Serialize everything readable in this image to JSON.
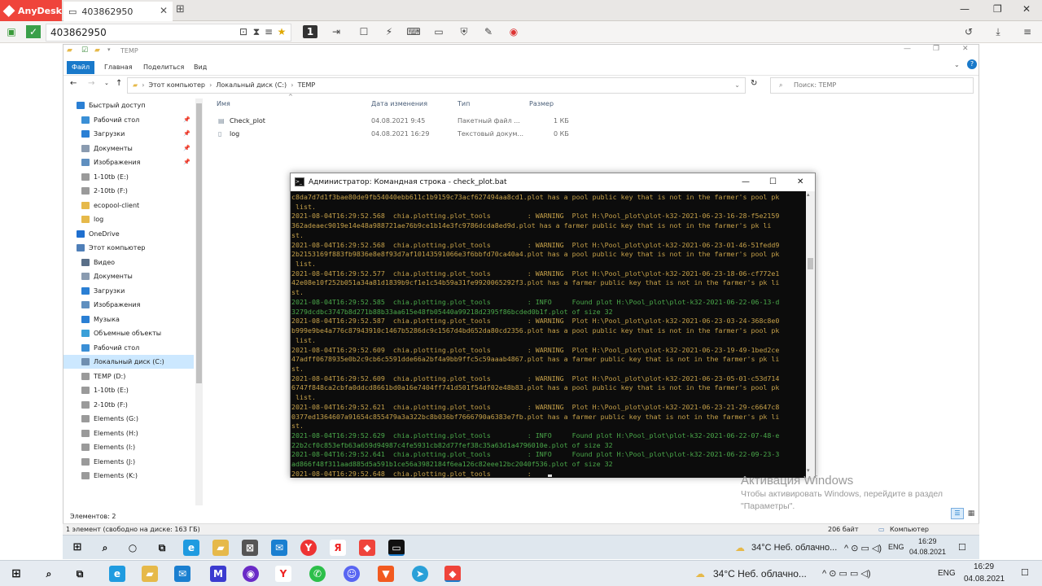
{
  "anydesk": {
    "brand": "AnyDesk",
    "tab_title": "403862950",
    "address": "403862950",
    "active_monitor": "1"
  },
  "explorer": {
    "quick_title": "TEMP",
    "ribbon_tabs": [
      "Файл",
      "Главная",
      "Поделиться",
      "Вид"
    ],
    "path": [
      "Этот компьютер",
      "Локальный диск (C:)",
      "TEMP"
    ],
    "search_placeholder": "Поиск: TEMP",
    "sidebar": [
      {
        "label": "Быстрый доступ",
        "color": "#2a7fd4",
        "pinned": false,
        "indent": 0
      },
      {
        "label": "Рабочий стол",
        "color": "#3a8fd6",
        "pinned": true,
        "indent": 1
      },
      {
        "label": "Загрузки",
        "color": "#2a7fd4",
        "pinned": true,
        "indent": 1
      },
      {
        "label": "Документы",
        "color": "#8a9bb0",
        "pinned": true,
        "indent": 1
      },
      {
        "label": "Изображения",
        "color": "#5f8fbf",
        "pinned": true,
        "indent": 1
      },
      {
        "label": "1-10tb (E:)",
        "color": "#9a9a9a",
        "pinned": false,
        "indent": 1
      },
      {
        "label": "2-10tb (F:)",
        "color": "#9a9a9a",
        "pinned": false,
        "indent": 1
      },
      {
        "label": "ecopool-client",
        "color": "#e6b94a",
        "pinned": false,
        "indent": 1
      },
      {
        "label": "log",
        "color": "#e6b94a",
        "pinned": false,
        "indent": 1
      },
      {
        "label": "OneDrive",
        "color": "#1f6fcf",
        "pinned": false,
        "indent": 0
      },
      {
        "label": "Этот компьютер",
        "color": "#4f7fb8",
        "pinned": false,
        "indent": 0
      },
      {
        "label": "Видео",
        "color": "#5a6f88",
        "pinned": false,
        "indent": 1
      },
      {
        "label": "Документы",
        "color": "#8a9bb0",
        "pinned": false,
        "indent": 1
      },
      {
        "label": "Загрузки",
        "color": "#2a7fd4",
        "pinned": false,
        "indent": 1
      },
      {
        "label": "Изображения",
        "color": "#5f8fbf",
        "pinned": false,
        "indent": 1
      },
      {
        "label": "Музыка",
        "color": "#2a7fd4",
        "pinned": false,
        "indent": 1
      },
      {
        "label": "Объемные объекты",
        "color": "#3aa0d8",
        "pinned": false,
        "indent": 1
      },
      {
        "label": "Рабочий стол",
        "color": "#3a8fd6",
        "pinned": false,
        "indent": 1
      },
      {
        "label": "Локальный диск (C:)",
        "color": "#6f8fb0",
        "pinned": false,
        "indent": 1
      },
      {
        "label": "TEMP (D:)",
        "color": "#9a9a9a",
        "pinned": false,
        "indent": 1
      },
      {
        "label": "1-10tb (E:)",
        "color": "#9a9a9a",
        "pinned": false,
        "indent": 1
      },
      {
        "label": "2-10tb (F:)",
        "color": "#9a9a9a",
        "pinned": false,
        "indent": 1
      },
      {
        "label": "Elements (G:)",
        "color": "#9a9a9a",
        "pinned": false,
        "indent": 1
      },
      {
        "label": "Elements (H:)",
        "color": "#9a9a9a",
        "pinned": false,
        "indent": 1
      },
      {
        "label": "Elements (I:)",
        "color": "#9a9a9a",
        "pinned": false,
        "indent": 1
      },
      {
        "label": "Elements (J:)",
        "color": "#9a9a9a",
        "pinned": false,
        "indent": 1
      },
      {
        "label": "Elements (K:)",
        "color": "#9a9a9a",
        "pinned": false,
        "indent": 1
      }
    ],
    "selected_sidebar_index": 18,
    "columns": [
      "Имя",
      "Дата изменения",
      "Тип",
      "Размер"
    ],
    "files": [
      {
        "name": "Check_plot",
        "date": "04.08.2021 9:45",
        "type": "Пакетный файл ...",
        "size": "1 КБ"
      },
      {
        "name": "log",
        "date": "04.08.2021 16:29",
        "type": "Текстовый докум...",
        "size": "0 КБ"
      }
    ],
    "elements_count": "Элементов: 2",
    "status_left": "1 элемент (свободно на диске: 163 ГБ)",
    "status_size": "206 байт",
    "status_location": "Компьютер"
  },
  "cmd": {
    "title": "Администратор: Командная строка - check_plot.bat",
    "lines": [
      {
        "text": "c8da7d7d1f3bae80de9fb54040ebb611c1b9159c73acf627494aa8cd1.plot has a pool public key that is not in the farmer's pool pk",
        "cls": "warn"
      },
      {
        "text": " list.",
        "cls": "warn"
      },
      {
        "text": "2021-08-04T16:29:52.568  chia.plotting.plot_tools         : WARNING  Plot H:\\Pool_plot\\plot-k32-2021-06-23-16-28-f5e2159",
        "cls": "warn"
      },
      {
        "text": "362adeaec9019e14e48a988721ae76b9ce1b14e3fc9786dcda8ed9d.plot has a farmer public key that is not in the farmer's pk li",
        "cls": "warn"
      },
      {
        "text": "st.",
        "cls": "warn"
      },
      {
        "text": "2021-08-04T16:29:52.568  chia.plotting.plot_tools         : WARNING  Plot H:\\Pool_plot\\plot-k32-2021-06-23-01-46-51fedd9",
        "cls": "warn"
      },
      {
        "text": "2b2153169f883fb9836e8e8f93d7af10143591066e3f6bbfd70ca40a4.plot has a pool public key that is not in the farmer's pool pk",
        "cls": "warn"
      },
      {
        "text": " list.",
        "cls": "warn"
      },
      {
        "text": "2021-08-04T16:29:52.577  chia.plotting.plot_tools         : WARNING  Plot H:\\Pool_plot\\plot-k32-2021-06-23-18-06-cf772e1",
        "cls": "warn"
      },
      {
        "text": "42e08e10f252b051a34a81d1839b9cf1e1c54b59a31fe9920065292f3.plot has a farmer public key that is not in the farmer's pk li",
        "cls": "warn"
      },
      {
        "text": "st.",
        "cls": "warn"
      },
      {
        "text": "2021-08-04T16:29:52.585  chia.plotting.plot_tools         : INFO     Found plot H:\\Pool_plot\\plot-k32-2021-06-22-06-13-d",
        "cls": "info"
      },
      {
        "text": "3279dcdbc3747b8d271b88b33aa615e48fb05440a99218d2395f86bcded0b1f.plot of size 32",
        "cls": "info"
      },
      {
        "text": "2021-08-04T16:29:52.587  chia.plotting.plot_tools         : WARNING  Plot H:\\Pool_plot\\plot-k32-2021-06-23-03-24-368c8e0",
        "cls": "warn"
      },
      {
        "text": "b999e9be4a776c87943910c1467b5286dc9c1567d4bd652da80cd2356.plot has a pool public key that is not in the farmer's pool pk",
        "cls": "warn"
      },
      {
        "text": " list.",
        "cls": "warn"
      },
      {
        "text": "2021-08-04T16:29:52.609  chia.plotting.plot_tools         : WARNING  Plot H:\\Pool_plot\\plot-k32-2021-06-23-19-49-1bed2ce",
        "cls": "warn"
      },
      {
        "text": "47adff0678935e0b2c9cb6c5591dde66a2bf4a9bb9ffc5c59aaab4867.plot has a farmer public key that is not in the farmer's pk li",
        "cls": "warn"
      },
      {
        "text": "st.",
        "cls": "warn"
      },
      {
        "text": "2021-08-04T16:29:52.609  chia.plotting.plot_tools         : WARNING  Plot H:\\Pool_plot\\plot-k32-2021-06-23-05-01-c53d714",
        "cls": "warn"
      },
      {
        "text": "6747f848ca2cbfa0ddcd8661bd0a16e7404ff741d501f54df02e48b83.plot has a pool public key that is not in the farmer's pool pk",
        "cls": "warn"
      },
      {
        "text": " list.",
        "cls": "warn"
      },
      {
        "text": "2021-08-04T16:29:52.621  chia.plotting.plot_tools         : WARNING  Plot H:\\Pool_plot\\plot-k32-2021-06-23-21-29-c6647c8",
        "cls": "warn"
      },
      {
        "text": "0377ed1364607a91654c855479a3a322bc8b036bf7666790a6383e7fb.plot has a farmer public key that is not in the farmer's pk li",
        "cls": "warn"
      },
      {
        "text": "st.",
        "cls": "warn"
      },
      {
        "text": "2021-08-04T16:29:52.629  chia.plotting.plot_tools         : INFO     Found plot H:\\Pool_plot\\plot-k32-2021-06-22-07-48-e",
        "cls": "info"
      },
      {
        "text": "22b2cf0c853efb63a659d94987c4fe5931cb82d77fef38c35a63d1a4796010e.plot of size 32",
        "cls": "info"
      },
      {
        "text": "2021-08-04T16:29:52.641  chia.plotting.plot_tools         : INFO     Found plot H:\\Pool_plot\\plot-k32-2021-06-22-09-23-3",
        "cls": "info"
      },
      {
        "text": "ad866f48f311aad885d5a591b1ce56a3982184f6ea126c82eee12bc2040f536.plot of size 32",
        "cls": "info"
      },
      {
        "text": "2021-08-04T16:29:52.648  chia.plotting.plot_tools         : ",
        "cls": "warn"
      }
    ]
  },
  "watermark": {
    "title": "Активация Windows",
    "line1": "Чтобы активировать Windows, перейдите в раздел",
    "line2": "\"Параметры\"."
  },
  "taskbar_remote": {
    "weather": "34°C  Неб. облачно...",
    "lang": "ENG",
    "time": "16:29",
    "date": "04.08.2021"
  },
  "taskbar_local": {
    "weather": "34°C  Неб. облачно...",
    "lang": "ENG",
    "time": "16:29",
    "date": "04.08.2021"
  }
}
